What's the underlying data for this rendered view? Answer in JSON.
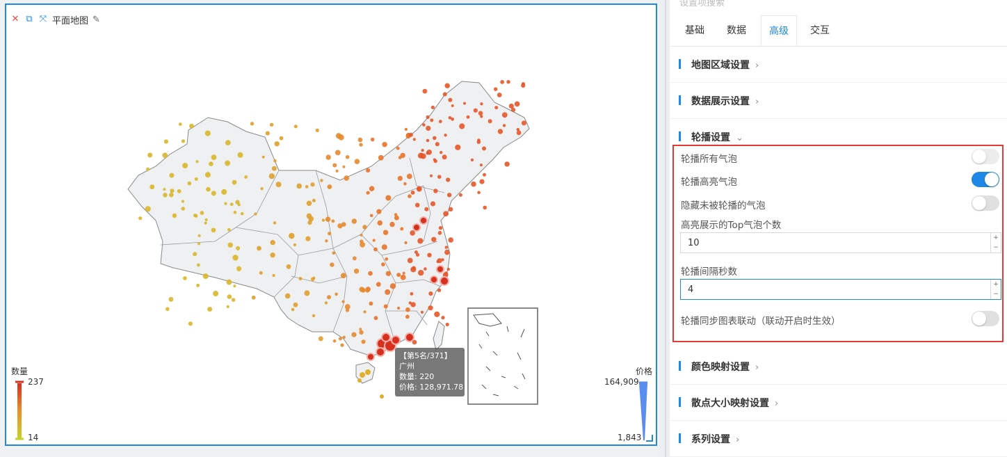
{
  "chart": {
    "title": "平面地图",
    "legend_left": {
      "title": "数量",
      "max": "237",
      "min": "14"
    },
    "legend_right": {
      "title": "价格",
      "max": "164,909",
      "min": "1,843"
    },
    "tooltip": {
      "rank": "【第5名/371】",
      "city": "广州",
      "count": "数量: 220",
      "price": "价格: 128,971.78"
    }
  },
  "panel": {
    "search_placeholder": "设置项搜索",
    "tabs": [
      "基础",
      "数据",
      "高级",
      "交互"
    ],
    "active_tab": "高级",
    "sections": {
      "map_region": "地图区域设置",
      "data_display": "数据展示设置",
      "carousel": "轮播设置",
      "color_map": "颜色映射设置",
      "scatter_size": "散点大小映射设置",
      "series": "系列设置"
    },
    "carousel": {
      "all_bubbles": {
        "label": "轮播所有气泡",
        "on": false
      },
      "highlight_bubbles": {
        "label": "轮播高亮气泡",
        "on": true
      },
      "hide_unplayed": {
        "label": "隐藏未被轮播的气泡",
        "on": false
      },
      "top_count_label": "高亮展示的Top气泡个数",
      "top_count_value": "10",
      "interval_label": "轮播间隔秒数",
      "interval_value": "4",
      "sync_label": "轮播同步图表联动（联动开启时生效）",
      "sync_on": false
    }
  },
  "colors": {
    "accent": "#1e88e5",
    "highlight_border": "#e53935",
    "legend_high": "#d7301f",
    "legend_low": "#c7d12a"
  }
}
